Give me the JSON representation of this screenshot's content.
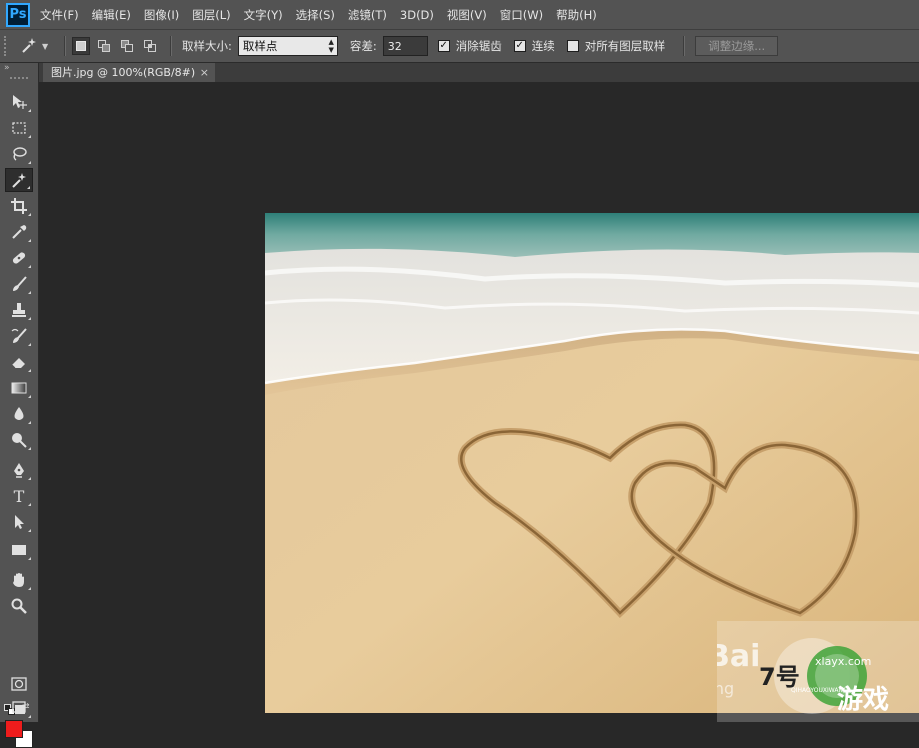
{
  "app": {
    "logo": "Ps",
    "menus": [
      "文件(F)",
      "编辑(E)",
      "图像(I)",
      "图层(L)",
      "文字(Y)",
      "选择(S)",
      "滤镜(T)",
      "3D(D)",
      "视图(V)",
      "窗口(W)",
      "帮助(H)"
    ]
  },
  "options": {
    "tool_icon": "magic-wand-icon",
    "selection_modes": [
      "new-selection",
      "add-to-selection",
      "subtract-from-selection",
      "intersect-selection"
    ],
    "active_mode": "new-selection",
    "sample_size_label": "取样大小:",
    "sample_size_value": "取样点",
    "tolerance_label": "容差:",
    "tolerance_value": "32",
    "antialias_label": "消除锯齿",
    "antialias_checked": true,
    "contiguous_label": "连续",
    "contiguous_checked": true,
    "sample_all_label": "对所有图层取样",
    "sample_all_checked": false,
    "refine_edge_label": "调整边缘..."
  },
  "document": {
    "tab_title": "图片.jpg @ 100%(RGB/8#)",
    "close_glyph": "×"
  },
  "tools": [
    "move-tool-icon",
    "marquee-tool-icon",
    "lasso-tool-icon",
    "magic-wand-tool-icon",
    "crop-tool-icon",
    "eyedropper-tool-icon",
    "healing-brush-tool-icon",
    "brush-tool-icon",
    "clone-stamp-tool-icon",
    "history-brush-tool-icon",
    "eraser-tool-icon",
    "gradient-tool-icon",
    "blur-tool-icon",
    "dodge-tool-icon",
    "pen-tool-icon",
    "type-tool-icon",
    "path-selection-tool-icon",
    "rectangle-tool-icon",
    "hand-tool-icon",
    "zoom-tool-icon"
  ],
  "active_tool": "magic-wand-tool-icon",
  "type_tool_glyph": "T",
  "colors": {
    "foreground": "#ee1c1c",
    "background": "#ffffff",
    "ui_panel": "#535353",
    "workspace": "#282828"
  },
  "watermark": {
    "baidu_text": "Bai",
    "jingyan_text": "jing",
    "site_number": "7号",
    "site_name": "游戏",
    "site_pinyin": "QIHAOYOUXIWANG",
    "site_domain": "xlayx.com"
  }
}
